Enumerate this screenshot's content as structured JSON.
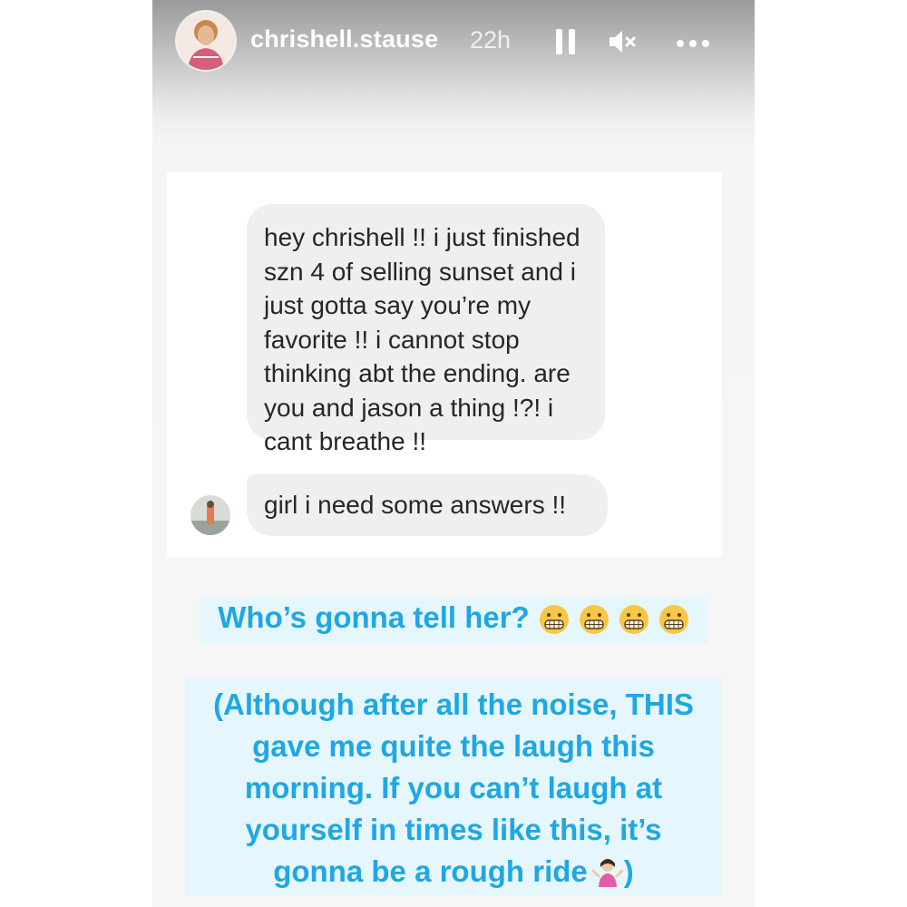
{
  "story": {
    "username": "chrishell.stause",
    "time": "22h",
    "icons": [
      "pause-icon",
      "mute-icon",
      "more-icon"
    ]
  },
  "dm": {
    "message_1_lines": [
      "hey chrishell !! i just finished",
      "szn 4 of selling sunset and i",
      "just gotta say you’re my",
      "favorite !! i cannot stop",
      "thinking abt the ending. are",
      "you and jason a thing !?! i",
      "cant breathe !!"
    ],
    "message_2": "girl i need some answers !!"
  },
  "captions": {
    "caption_1": "Who’s gonna tell her?",
    "caption_1_emoji": "grimacing-face x4",
    "caption_2_lines": [
      "(Although after all the noise, THIS",
      "gave me quite the laugh this",
      "morning. If you can’t laugh at",
      "yourself in times like this, it’s",
      "gonna be a rough ride"
    ],
    "caption_2_end": ")",
    "caption_2_emoji": "woman-shrugging"
  },
  "colors": {
    "caption_text": "#1fa7e4",
    "caption_bg": "#e6f6fd",
    "bubble_bg": "#efefef"
  }
}
